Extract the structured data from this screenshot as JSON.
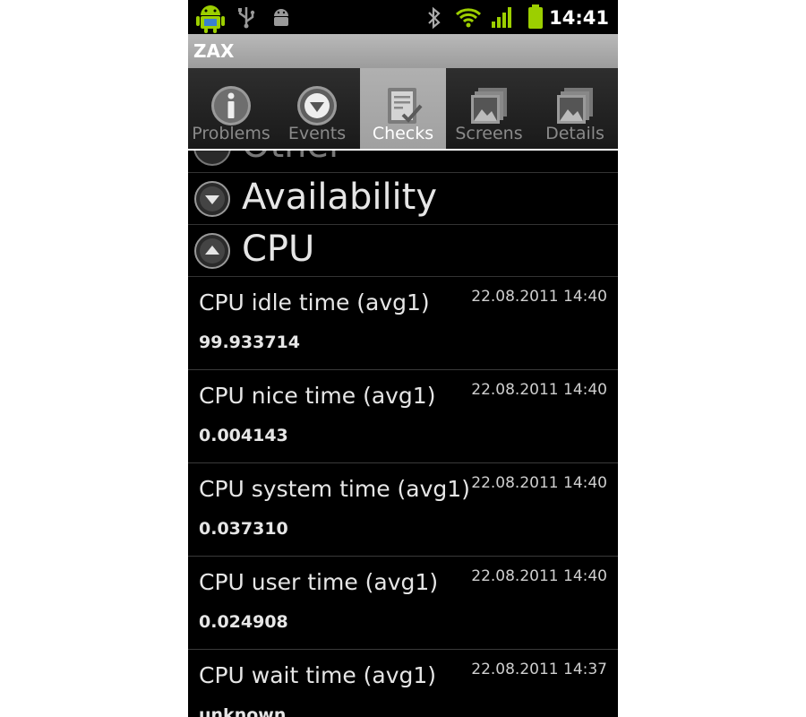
{
  "status_bar": {
    "time": "14:41",
    "icons": [
      "android-logo-icon",
      "usb-icon",
      "debug-android-icon",
      "bluetooth-icon",
      "wifi-icon",
      "signal-icon",
      "battery-icon"
    ],
    "accent_color": "#9ccf00"
  },
  "app": {
    "title": "ZAX"
  },
  "tabs": [
    {
      "label": "Problems",
      "icon": "info-icon",
      "selected": false
    },
    {
      "label": "Events",
      "icon": "down-arrow-circle-icon",
      "selected": false
    },
    {
      "label": "Checks",
      "icon": "checklist-icon",
      "selected": true
    },
    {
      "label": "Screens",
      "icon": "images-icon",
      "selected": false
    },
    {
      "label": "Details",
      "icon": "images-icon",
      "selected": false
    }
  ],
  "groups": {
    "partial": {
      "label": "Other",
      "state": "expandable"
    },
    "availability": {
      "label": "Availability",
      "state": "collapsed"
    },
    "cpu": {
      "label": "CPU",
      "state": "expanded"
    }
  },
  "items": [
    {
      "name": "CPU idle time (avg1)",
      "time": "22.08.2011 14:40",
      "value": "99.933714"
    },
    {
      "name": "CPU nice time (avg1)",
      "time": "22.08.2011 14:40",
      "value": "0.004143"
    },
    {
      "name": "CPU system time (avg1)",
      "time": "22.08.2011 14:40",
      "value": "0.037310"
    },
    {
      "name": "CPU user time (avg1)",
      "time": "22.08.2011 14:40",
      "value": "0.024908"
    },
    {
      "name": "CPU wait time (avg1)",
      "time": "22.08.2011 14:37",
      "value": "unknown"
    }
  ]
}
